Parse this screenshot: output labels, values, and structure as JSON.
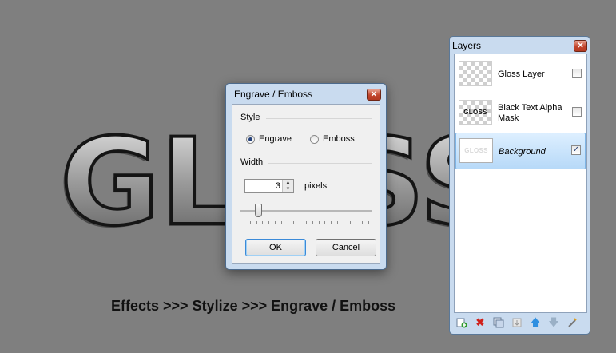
{
  "canvas": {
    "art_text": "GLOSS",
    "caption": "Effects >>> Stylize >>> Engrave / Emboss"
  },
  "dialog": {
    "title": "Engrave / Emboss",
    "style_label": "Style",
    "options": [
      {
        "label": "Engrave",
        "checked": true
      },
      {
        "label": "Emboss",
        "checked": false
      }
    ],
    "width_label": "Width",
    "width_value": "3",
    "width_units": "pixels",
    "slider_value": 3,
    "ok_label": "OK",
    "cancel_label": "Cancel",
    "close_glyph": "✕"
  },
  "layers_panel": {
    "title": "Layers",
    "close_glyph": "✕",
    "layers": [
      {
        "name": "Gloss Layer",
        "visible": false,
        "selected": false,
        "thumb_text": ""
      },
      {
        "name": "Black Text Alpha Mask",
        "visible": false,
        "selected": false,
        "thumb_text": "GLOSS"
      },
      {
        "name": "Background",
        "visible": true,
        "selected": true,
        "thumb_text": "GLOSS"
      }
    ],
    "toolbar_icons": [
      "add-layer-icon",
      "delete-layer-icon",
      "duplicate-layer-icon",
      "merge-layer-icon",
      "move-up-icon",
      "move-down-icon",
      "properties-icon"
    ]
  },
  "colors": {
    "background": "#7f7f7f",
    "window_frame": "#c9dbef",
    "selection": "#b7d9f8",
    "close_button": "#c2452c"
  }
}
